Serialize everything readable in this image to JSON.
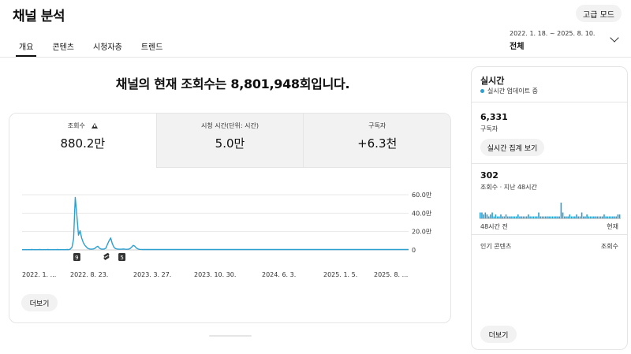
{
  "header": {
    "title": "채널 분석",
    "advanced_mode": "고급 모드",
    "tabs": [
      {
        "label": "개요",
        "active": true
      },
      {
        "label": "콘텐츠",
        "active": false
      },
      {
        "label": "시청자층",
        "active": false
      },
      {
        "label": "트렌드",
        "active": false
      }
    ],
    "date_range": "2022. 1. 18. ~ 2025. 8. 10.",
    "date_range_label": "전체"
  },
  "main": {
    "headline": "채널의 현재 조회수는 8,801,948회입니다.",
    "metrics": [
      {
        "label": "조회수",
        "value": "880.2만",
        "active": true,
        "warning": true
      },
      {
        "label": "시청 시간(단위: 시간)",
        "value": "5.0만",
        "active": false
      },
      {
        "label": "구독자",
        "value": "+6.3천",
        "active": false
      }
    ],
    "more_label": "더보기"
  },
  "chart_data": {
    "type": "line",
    "series": [
      {
        "values": [
          0.3,
          0.3,
          0.3,
          0.3,
          0.3,
          0.3,
          0.4,
          0.3,
          0.3,
          0.3,
          0.3,
          0.4,
          0.3,
          0.3,
          0.3,
          0.3,
          0.4,
          0.3,
          0.3,
          0.3,
          0.3,
          0.3,
          0.4,
          0.3,
          0.3,
          0.3,
          0.3,
          0.3,
          0.4,
          0.3,
          1,
          3,
          12,
          57,
          38,
          16,
          21,
          13,
          8,
          5,
          3,
          1.5,
          1,
          0.8,
          1,
          1.5,
          3,
          4,
          2,
          1,
          0.8,
          1,
          1.8,
          6,
          10,
          13,
          7,
          3,
          1.5,
          1,
          0.8,
          0.8,
          0.9,
          1,
          0.8,
          0.7,
          0.8,
          1.5,
          3,
          5,
          4,
          2,
          1,
          0.6,
          0.5,
          0.4,
          0.5,
          0.4,
          0.5,
          0.4,
          0.4,
          0.4,
          0.5,
          0.4,
          0.4,
          0.4,
          0.4,
          0.4,
          0.4,
          0.4,
          0.4,
          0.4,
          0.4,
          0.4,
          0.4,
          0.4,
          0.4,
          0.4,
          0.4,
          0.4,
          0.4,
          0.4,
          0.4,
          0.4,
          0.4,
          0.4,
          0.4,
          0.4,
          0.4,
          0.4,
          0.4,
          0.4,
          0.4,
          0.4,
          0.4,
          0.4,
          0.4,
          0.4,
          0.4,
          0.4,
          0.4,
          0.4,
          0.4,
          0.4,
          0.4,
          0.4,
          0.4,
          0.4,
          0.4,
          0.4,
          0.4,
          0.4,
          0.4,
          0.4,
          0.4,
          0.4,
          0.4,
          0.4,
          0.4,
          0.4,
          0.4,
          0.4,
          0.4,
          0.4,
          0.4,
          0.4,
          0.4,
          0.4,
          0.4,
          0.4,
          0.4,
          0.4,
          0.4,
          0.4,
          0.4,
          0.4,
          0.4,
          0.4,
          0.4,
          0.4,
          0.4,
          0.4,
          0.4,
          0.4,
          0.4,
          0.4,
          0.4,
          0.4,
          0.4,
          0.4,
          0.4,
          0.4,
          0.4,
          0.4,
          0.4,
          0.4,
          0.4,
          0.4,
          0.4,
          0.4,
          0.4,
          0.4,
          0.4,
          0.4,
          0.4,
          0.4,
          0.4,
          0.4,
          0.4,
          0.4,
          0.4,
          0.4,
          0.4,
          0.4,
          0.4,
          0.4,
          0.4,
          0.4,
          0.4,
          0.4,
          0.4,
          0.4,
          0.4,
          0.4,
          0.4,
          0.4,
          0.4,
          0.4,
          0.4,
          0.4,
          0.4,
          0.4,
          0.4,
          0.4,
          0.4,
          0.4,
          0.4,
          0.4,
          0.4,
          0.4,
          0.4,
          0.4,
          0.4,
          0.4,
          0.4,
          0.4,
          0.4,
          0.4,
          0.4,
          0.4,
          0.4,
          0.4,
          0.4,
          0.4,
          0.4,
          0.4,
          0.4,
          0.4,
          0.4,
          0.4,
          0.4
        ]
      }
    ],
    "ylim": [
      0,
      60
    ],
    "yticks": [
      {
        "value": 60,
        "label": "60.0만"
      },
      {
        "value": 40,
        "label": "40.0만"
      },
      {
        "value": 20,
        "label": "20.0만"
      },
      {
        "value": 0,
        "label": "0"
      }
    ],
    "xtick_labels": [
      "2022. 1. ...",
      "2022. 8. 23.",
      "2023. 3. 27.",
      "2023. 10. 30.",
      "2024. 6. 3.",
      "2025. 1. 5.",
      "2025. 8. ..."
    ],
    "markers": [
      {
        "index": 34,
        "kind": "count",
        "label": "9"
      },
      {
        "index": 52,
        "kind": "shorts",
        "label": ""
      },
      {
        "index": 62,
        "kind": "count",
        "label": "5"
      }
    ],
    "color": "#2b9fd0",
    "grid": true
  },
  "sidebar": {
    "title": "실시간",
    "live_text": "실시간 업데이트 중",
    "subscribers_value": "6,331",
    "subscribers_label": "구독자",
    "realtime_button": "실시간 집계 보기",
    "views_value": "302",
    "views_label": "조회수 · 지난 48시간",
    "bars": [
      3,
      3,
      2,
      3,
      2,
      1,
      2,
      3,
      1,
      2,
      1,
      1,
      2,
      1,
      1,
      2,
      1,
      1,
      1,
      1,
      1,
      1,
      2,
      1,
      1,
      1,
      1,
      1,
      2,
      1,
      1,
      1,
      1,
      1,
      3,
      1,
      1,
      1,
      1,
      1,
      1,
      1,
      1,
      1,
      1,
      1,
      1,
      8,
      3,
      1,
      1,
      1,
      2,
      1,
      1,
      1,
      2,
      1,
      1,
      3,
      1,
      1,
      2,
      1,
      1,
      1,
      1,
      1,
      1,
      1,
      1,
      1,
      2,
      1,
      1,
      1,
      1,
      1,
      1,
      1,
      2,
      2
    ],
    "axis_left": "48시간 전",
    "axis_right": "현재",
    "popular_label": "인기 콘텐츠",
    "popular_metric": "조회수",
    "more_label": "더보기"
  },
  "colors": {
    "accent": "#2b9fd0",
    "surface": "#f2f2f2",
    "border": "#e5e5e5"
  }
}
